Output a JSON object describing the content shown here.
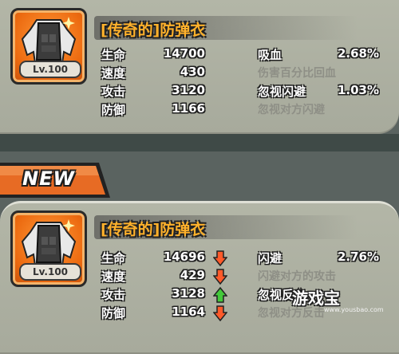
{
  "current_item": {
    "name": "[传奇的]防弹衣",
    "level": "Lv.100",
    "icon": "bulletproof-vest-icon",
    "stats": [
      {
        "label": "生命",
        "value": "14700"
      },
      {
        "label": "速度",
        "value": "430"
      },
      {
        "label": "攻击",
        "value": "3120"
      },
      {
        "label": "防御",
        "value": "1166"
      }
    ],
    "passives": [
      {
        "name": "吸血",
        "value": "2.68%",
        "desc": "伤害百分比回血"
      },
      {
        "name": "忽视闪避",
        "value": "1.03%",
        "desc": "忽视对方闪避"
      }
    ]
  },
  "new_banner": "NEW",
  "new_item": {
    "name": "[传奇的]防弹衣",
    "level": "Lv.100",
    "icon": "bulletproof-vest-icon",
    "stats": [
      {
        "label": "生命",
        "value": "14696",
        "trend": "down"
      },
      {
        "label": "速度",
        "value": "429",
        "trend": "down"
      },
      {
        "label": "攻击",
        "value": "3128",
        "trend": "up"
      },
      {
        "label": "防御",
        "value": "1164",
        "trend": "down"
      }
    ],
    "passives": [
      {
        "name": "闪避",
        "value": "2.76%",
        "desc": "闪避对方的攻击"
      },
      {
        "name": "忽视反击",
        "value": "",
        "desc": "忽视对方反击"
      }
    ]
  },
  "watermark": {
    "title": "游戏宝",
    "url": "www.yousbao.com"
  },
  "colors": {
    "name": "#ffb12b",
    "up": "#43c93a",
    "down": "#ff5a2a",
    "icon_bg": "#ec6a10"
  }
}
